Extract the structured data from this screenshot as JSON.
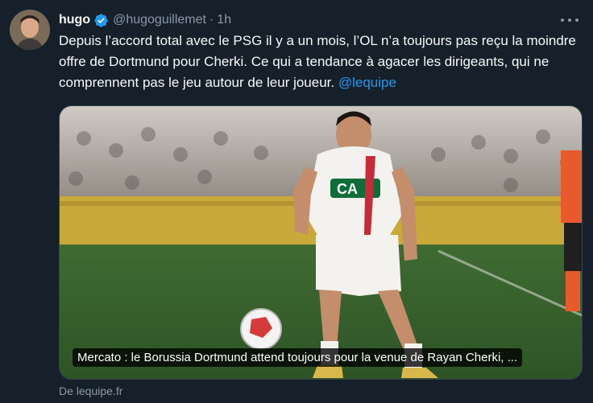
{
  "author": {
    "name": "hugo",
    "handle": "@hugoguillemet",
    "separator": "·",
    "time": "1h"
  },
  "tweet": {
    "text": "Depuis l’accord total avec le PSG il y a un mois, l’OL n’a toujours pas reçu la moindre offre de Dortmund pour Cherki. Ce qui a tendance à agacer les dirigeants, qui ne comprennent pas le jeu autour de leur joueur.",
    "mention": "@lequipe"
  },
  "card": {
    "caption": "Mercato : le Borussia Dortmund attend toujours pour la venue de Rayan Cherki, ...",
    "jersey_logo": "CA"
  },
  "source": "De lequipe.fr",
  "icons": [
    "verified-badge-icon",
    "more-options-icon"
  ],
  "colors": {
    "background": "#15202b",
    "link": "#1d9bf0",
    "muted": "#8b98a5",
    "verified": "#1d9bf0"
  }
}
